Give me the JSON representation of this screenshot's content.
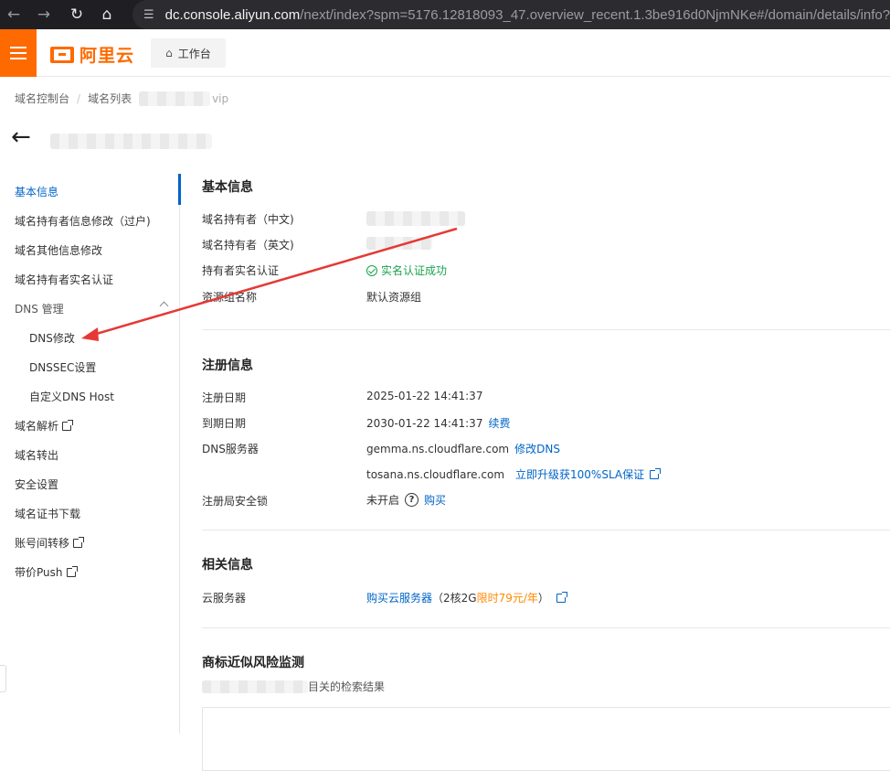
{
  "browser": {
    "url_host": "dc.console.aliyun.com",
    "url_path": "/next/index?spm=5176.12818093_47.overview_recent.1.3be916d0NjmNKe#/domain/details/info?s"
  },
  "header": {
    "logo_text": "阿里云",
    "workbench_label": "工作台"
  },
  "breadcrumb": {
    "items": [
      "域名控制台",
      "域名列表"
    ],
    "tail": "vip"
  },
  "sidebar": {
    "items": [
      {
        "label": "基本信息",
        "active": true
      },
      {
        "label": "域名持有者信息修改（过户)"
      },
      {
        "label": "域名其他信息修改"
      },
      {
        "label": "域名持有者实名认证"
      },
      {
        "label": "DNS 管理",
        "expanded": true
      },
      {
        "label": "DNS修改",
        "sub": true
      },
      {
        "label": "DNSSEC设置",
        "sub": true
      },
      {
        "label": "自定义DNS Host",
        "sub": true
      },
      {
        "label": "域名解析",
        "external": true
      },
      {
        "label": "域名转出"
      },
      {
        "label": "安全设置"
      },
      {
        "label": "域名证书下载"
      },
      {
        "label": "账号间转移",
        "external": true
      },
      {
        "label": "带价Push",
        "external": true
      }
    ]
  },
  "basic_info": {
    "title": "基本信息",
    "owner_cn_label": "域名持有者（中文)",
    "owner_en_label": "域名持有者（英文)",
    "verify_label": "持有者实名认证",
    "verify_value": "实名认证成功",
    "resource_group_label": "资源组名称",
    "resource_group_value": "默认资源组"
  },
  "registration": {
    "title": "注册信息",
    "reg_date_label": "注册日期",
    "reg_date_value": "2025-01-22 14:41:37",
    "expire_label": "到期日期",
    "expire_value": "2030-01-22 14:41:37",
    "renew_link": "续费",
    "dns_label": "DNS服务器",
    "dns_1": "gemma.ns.cloudflare.com",
    "dns_modify_link": "修改DNS",
    "dns_2": "tosana.ns.cloudflare.com",
    "sla_link": "立即升级获100%SLA保证",
    "lock_label": "注册局安全锁",
    "lock_value": "未开启",
    "lock_buy_link": "购买"
  },
  "related": {
    "title": "相关信息",
    "cloud_label": "云服务器",
    "cloud_link": "购买云服务器",
    "cloud_spec_prefix": "（2核2G",
    "cloud_promo": "限时79元/年",
    "cloud_spec_suffix": "）"
  },
  "trademark": {
    "title": "商标近似风险监测",
    "search_suffix": "目关的检索结果"
  },
  "colors": {
    "brand": "#ff6a00",
    "link": "#0064c8",
    "success": "#1aa34a",
    "promo": "#ff8a00",
    "annotation": "#e53935"
  }
}
